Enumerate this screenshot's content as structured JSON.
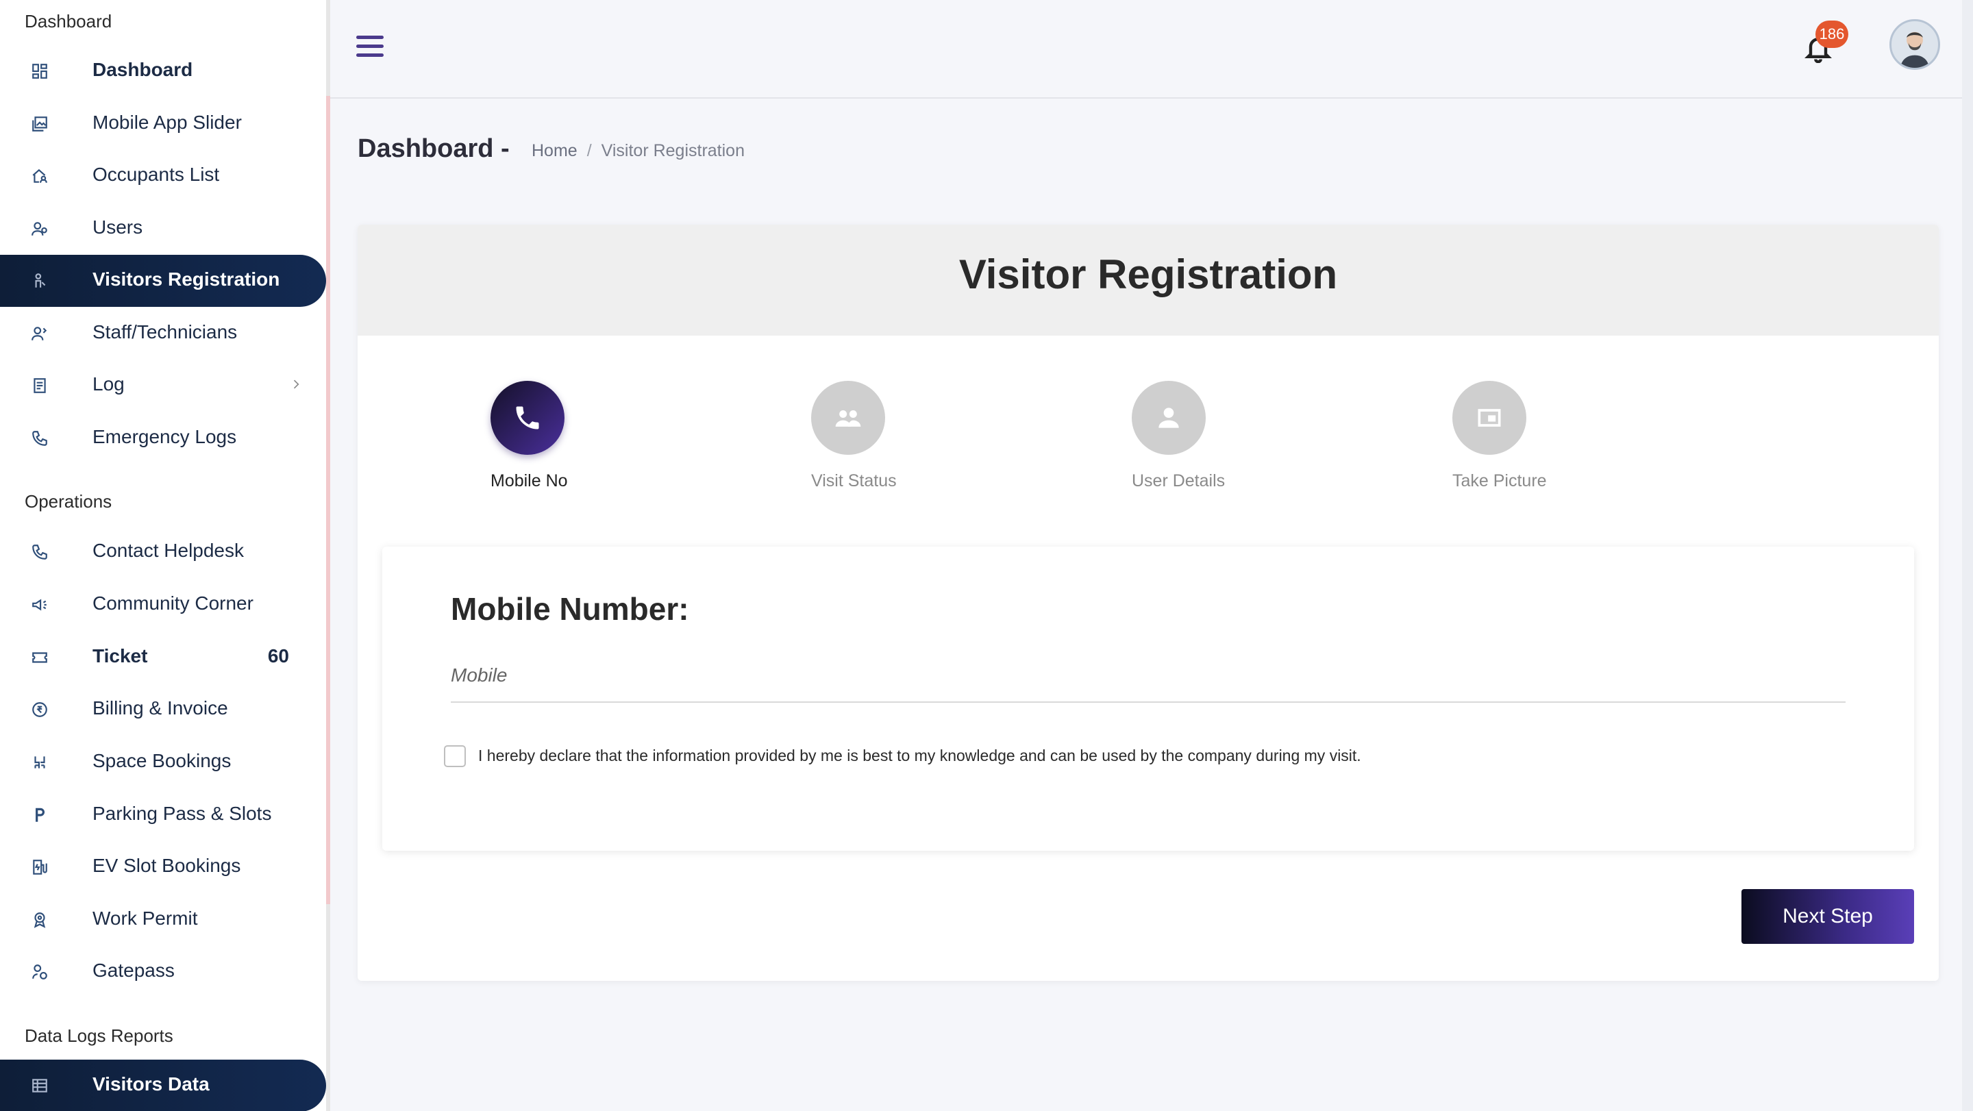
{
  "sidebar": {
    "sections": [
      {
        "title": "Dashboard"
      },
      {
        "title": "Operations"
      },
      {
        "title": "Data Logs Reports"
      }
    ],
    "items": [
      {
        "label": "Dashboard",
        "icon": "grid-icon"
      },
      {
        "label": "Mobile App Slider",
        "icon": "image-stack-icon"
      },
      {
        "label": "Occupants List",
        "icon": "home-user-icon"
      },
      {
        "label": "Users",
        "icon": "users-icon"
      },
      {
        "label": "Visitors Registration",
        "icon": "visitor-icon"
      },
      {
        "label": "Staff/Technicians",
        "icon": "staff-icon"
      },
      {
        "label": "Log",
        "icon": "log-icon"
      },
      {
        "label": "Emergency Logs",
        "icon": "phone-icon"
      },
      {
        "label": "Contact Helpdesk",
        "icon": "phone-icon"
      },
      {
        "label": "Community Corner",
        "icon": "megaphone-icon"
      },
      {
        "label": "Ticket",
        "icon": "ticket-icon",
        "badge": "60"
      },
      {
        "label": "Billing & Invoice",
        "icon": "rupee-icon"
      },
      {
        "label": "Space Bookings",
        "icon": "chairs-icon"
      },
      {
        "label": "Parking Pass & Slots",
        "icon": "parking-icon"
      },
      {
        "label": "EV Slot Bookings",
        "icon": "ev-icon"
      },
      {
        "label": "Work Permit",
        "icon": "badge-icon"
      },
      {
        "label": "Gatepass",
        "icon": "gatepass-icon"
      },
      {
        "label": "Visitors Data",
        "icon": "table-icon"
      }
    ]
  },
  "topbar": {
    "notification_count": "186"
  },
  "header": {
    "title": "Dashboard -",
    "breadcrumb": {
      "home": "Home",
      "separator": "/",
      "current": "Visitor Registration"
    }
  },
  "card": {
    "title": "Visitor Registration",
    "steps": [
      {
        "label": "Mobile No",
        "icon": "phone-icon",
        "active": true
      },
      {
        "label": "Visit Status",
        "icon": "group-icon",
        "active": false
      },
      {
        "label": "User Details",
        "icon": "person-icon",
        "active": false
      },
      {
        "label": "Take Picture",
        "icon": "picture-icon",
        "active": false
      }
    ],
    "form": {
      "field_title": "Mobile Number:",
      "mobile_placeholder": "Mobile",
      "mobile_value": "",
      "declaration": "I hereby declare that the information provided by me is best to my knowledge and can be used by the company during my visit.",
      "declaration_checked": false
    },
    "next_button": "Next Step"
  },
  "colors": {
    "sidebar_active": "#0e1e38",
    "accent": "#4a2f9c",
    "badge": "#e4572e"
  }
}
